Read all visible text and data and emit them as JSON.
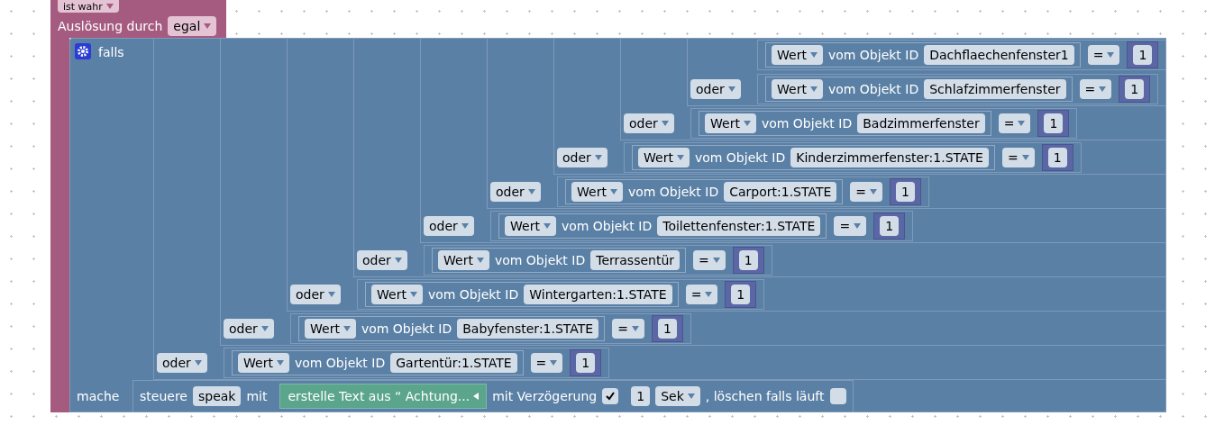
{
  "event_block": {
    "condition": "ist wahr",
    "trigger_label": "Auslösung durch",
    "trigger": "egal"
  },
  "if_block": {
    "label": "falls",
    "conditions": [
      {
        "source": "Wert",
        "object_label": "vom Objekt ID",
        "object_id": "Dachflaechenfenster1",
        "operator": "=",
        "value": "1"
      },
      {
        "joiner": "oder",
        "source": "Wert",
        "object_label": "vom Objekt ID",
        "object_id": "Schlafzimmerfenster",
        "operator": "=",
        "value": "1"
      },
      {
        "joiner": "oder",
        "source": "Wert",
        "object_label": "vom Objekt ID",
        "object_id": "Badzimmerfenster",
        "operator": "=",
        "value": "1"
      },
      {
        "joiner": "oder",
        "source": "Wert",
        "object_label": "vom Objekt ID",
        "object_id": "Kinderzimmerfenster:1.STATE",
        "operator": "=",
        "value": "1"
      },
      {
        "joiner": "oder",
        "source": "Wert",
        "object_label": "vom Objekt ID",
        "object_id": "Carport:1.STATE",
        "operator": "=",
        "value": "1"
      },
      {
        "joiner": "oder",
        "source": "Wert",
        "object_label": "vom Objekt ID",
        "object_id": "Toilettenfenster:1.STATE",
        "operator": "=",
        "value": "1"
      },
      {
        "joiner": "oder",
        "source": "Wert",
        "object_label": "vom Objekt ID",
        "object_id": "Terrassentür",
        "operator": "=",
        "value": "1"
      },
      {
        "joiner": "oder",
        "source": "Wert",
        "object_label": "vom Objekt ID",
        "object_id": "Wintergarten:1.STATE",
        "operator": "=",
        "value": "1"
      },
      {
        "joiner": "oder",
        "source": "Wert",
        "object_label": "vom Objekt ID",
        "object_id": "Babyfenster:1.STATE",
        "operator": "=",
        "value": "1"
      },
      {
        "joiner": "oder",
        "source": "Wert",
        "object_label": "vom Objekt ID",
        "object_id": "Gartentür:1.STATE",
        "operator": "=",
        "value": "1"
      }
    ],
    "do_label": "mache",
    "action": {
      "prefix": "steuere",
      "target": "speak",
      "with": "mit",
      "text": "erstelle Text aus “ Achtung...",
      "delay_label": "mit Verzögerung",
      "delay_enabled": true,
      "delay": "1",
      "unit": "Sek",
      "clear_label": ", löschen falls läuft",
      "clear_running": false
    }
  }
}
